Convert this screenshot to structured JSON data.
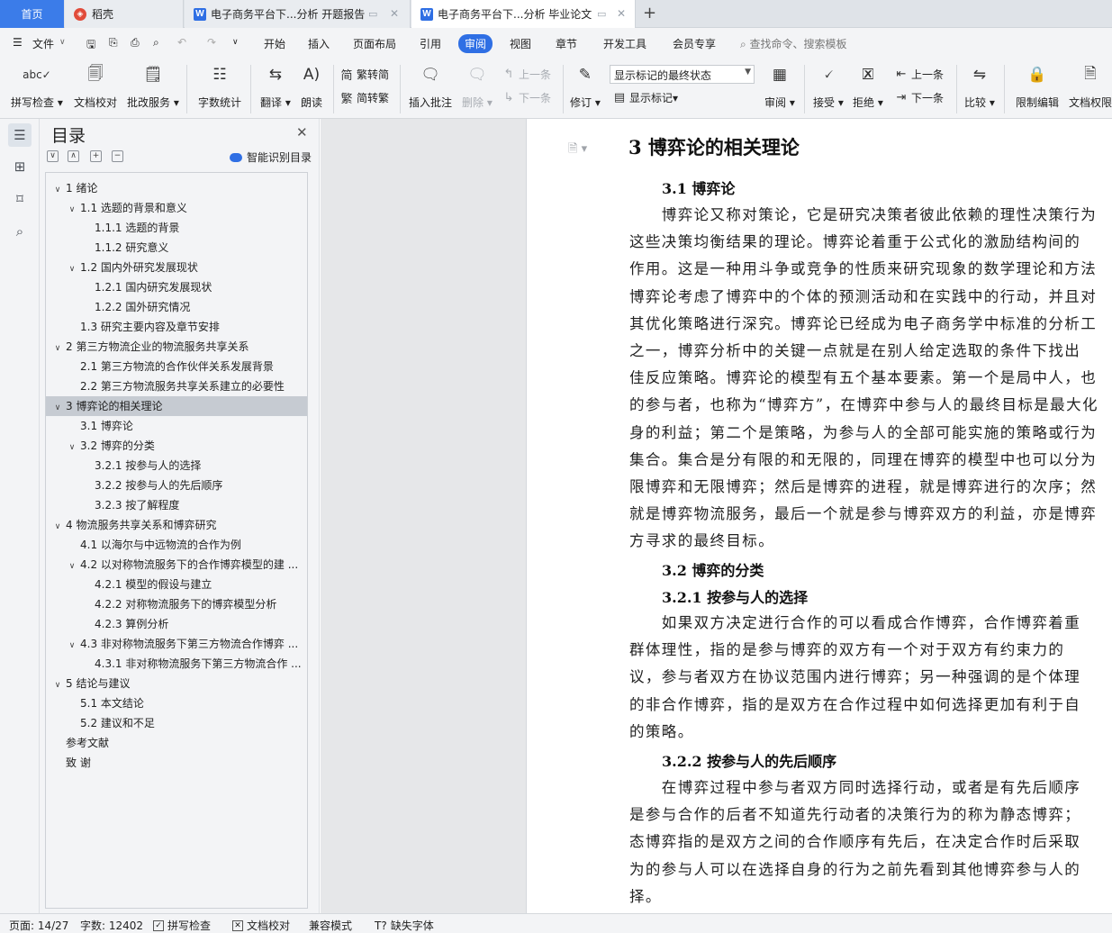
{
  "tabs": {
    "home": "首页",
    "daoke": "稻壳",
    "doc1": "电子商务平台下...分析 开题报告",
    "doc2": "电子商务平台下...分析 毕业论文"
  },
  "menu": {
    "file": "文件",
    "items": [
      "开始",
      "插入",
      "页面布局",
      "引用",
      "审阅",
      "视图",
      "章节",
      "开发工具",
      "会员专享"
    ],
    "active": "审阅",
    "search": "查找命令、搜索模板"
  },
  "ribbon": {
    "spellcheck": "拼写检查",
    "doc_proof": "文档校对",
    "batch_service": "批改服务",
    "word_count": "字数统计",
    "translate": "翻译",
    "read_aloud": "朗读",
    "trad_convert": "繁转简",
    "simp_convert": "简转繁",
    "insert_comment": "插入批注",
    "delete": "删除",
    "prev_comment": "上一条",
    "next_comment": "下一条",
    "track_changes": "修订",
    "markup_dropdown": "显示标记的最终状态",
    "show_markup": "显示标记",
    "review": "审阅",
    "accept": "接受",
    "reject": "拒绝",
    "prev_change": "上一条",
    "next_change": "下一条",
    "compare": "比较",
    "restrict_edit": "限制编辑",
    "doc_permission": "文档权限"
  },
  "toc": {
    "title": "目录",
    "smart": "智能识别目录",
    "items": [
      {
        "text": "1 绪论",
        "level": 1,
        "chevron": true
      },
      {
        "text": "1.1 选题的背景和意义",
        "level": 2,
        "chevron": true
      },
      {
        "text": "1.1.1 选题的背景",
        "level": 3,
        "chevron": false
      },
      {
        "text": "1.1.2 研究意义",
        "level": 3,
        "chevron": false
      },
      {
        "text": "1.2 国内外研究发展现状",
        "level": 2,
        "chevron": true
      },
      {
        "text": "1.2.1 国内研究发展现状",
        "level": 3,
        "chevron": false
      },
      {
        "text": "1.2.2 国外研究情况",
        "level": 3,
        "chevron": false
      },
      {
        "text": "1.3 研究主要内容及章节安排",
        "level": 2,
        "chevron": false
      },
      {
        "text": "2 第三方物流企业的物流服务共享关系",
        "level": 1,
        "chevron": true
      },
      {
        "text": "2.1 第三方物流的合作伙伴关系发展背景",
        "level": 2,
        "chevron": false
      },
      {
        "text": "2.2 第三方物流服务共享关系建立的必要性",
        "level": 2,
        "chevron": false
      },
      {
        "text": "3 博弈论的相关理论",
        "level": 1,
        "chevron": true,
        "selected": true
      },
      {
        "text": "3.1 博弈论",
        "level": 2,
        "chevron": false
      },
      {
        "text": "3.2 博弈的分类",
        "level": 2,
        "chevron": true
      },
      {
        "text": "3.2.1 按参与人的选择",
        "level": 3,
        "chevron": false
      },
      {
        "text": "3.2.2 按参与人的先后顺序",
        "level": 3,
        "chevron": false
      },
      {
        "text": "3.2.3 按了解程度",
        "level": 3,
        "chevron": false
      },
      {
        "text": "4 物流服务共享关系和博弈研究",
        "level": 1,
        "chevron": true
      },
      {
        "text": "4.1 以海尔与中远物流的合作为例",
        "level": 2,
        "chevron": false
      },
      {
        "text": "4.2 以对称物流服务下的合作博弈模型的建 ...",
        "level": 2,
        "chevron": true
      },
      {
        "text": "4.2.1 模型的假设与建立",
        "level": 3,
        "chevron": false
      },
      {
        "text": "4.2.2 对称物流服务下的博弈模型分析",
        "level": 3,
        "chevron": false
      },
      {
        "text": "4.2.3 算例分析",
        "level": 3,
        "chevron": false
      },
      {
        "text": "4.3 非对称物流服务下第三方物流合作博弈 ...",
        "level": 2,
        "chevron": true
      },
      {
        "text": "4.3.1 非对称物流服务下第三方物流合作 ...",
        "level": 3,
        "chevron": false
      },
      {
        "text": "5 结论与建议",
        "level": 1,
        "chevron": true
      },
      {
        "text": "5.1 本文结论",
        "level": 2,
        "chevron": false
      },
      {
        "text": "5.2 建议和不足",
        "level": 2,
        "chevron": false
      },
      {
        "text": "参考文献",
        "level": 1,
        "chevron": false,
        "nochev": true
      },
      {
        "text": "致  谢",
        "level": 1,
        "chevron": false,
        "nochev": true
      }
    ]
  },
  "document": {
    "heading": "3 博弈论的相关理论",
    "sec31": "3.1 博弈论",
    "p1": [
      "　　博弈论又称对策论，它是研究决策者彼此依赖的理性决策行为",
      "这些决策均衡结果的理论。博弈论着重于公式化的激励结构间的",
      "作用。这是一种用斗争或竞争的性质来研究现象的数学理论和方法",
      "博弈论考虑了博弈中的个体的预测活动和在实践中的行动，并且对",
      "其优化策略进行深究。博弈论已经成为电子商务学中标准的分析工",
      "之一，博弈分析中的关键一点就是在别人给定选取的条件下找出",
      "佳反应策略。博弈论的模型有五个基本要素。第一个是局中人，也",
      "的参与者，也称为“博弈方”，在博弈中参与人的最终目标是最大化",
      "身的利益；第二个是策略，为参与人的全部可能实施的策略或行为",
      "集合。集合是分有限的和无限的，同理在博弈的模型中也可以分为",
      "限博弈和无限博弈；然后是博弈的进程，就是博弈进行的次序；然",
      "就是博弈物流服务，最后一个就是参与博弈双方的利益，亦是博弈",
      "方寻求的最终目标。"
    ],
    "sec32": "3.2 博弈的分类",
    "sec321": "3.2.1 按参与人的选择",
    "p2": [
      "　　如果双方决定进行合作的可以看成合作博弈，合作博弈着重",
      "群体理性，指的是参与博弈的双方有一个对于双方有约束力的",
      "议，参与者双方在协议范围内进行博弈；另一种强调的是个体理",
      "的非合作博弈，指的是双方在合作过程中如何选择更加有利于自",
      "的策略。"
    ],
    "sec322": "3.2.2 按参与人的先后顺序",
    "p3": [
      "　　在博弈过程中参与者双方同时选择行动，或者是有先后顺序",
      "是参与合作的后者不知道先行动者的决策行为的称为静态博弈；",
      "态博弈指的是双方之间的合作顺序有先后，在决定合作时后采取",
      "为的参与人可以在选择自身的行为之前先看到其他博弈参与人的",
      "择。"
    ]
  },
  "status": {
    "page": "页面: 14/27",
    "words": "字数: 12402",
    "spell": "拼写检查",
    "proof": "文档校对",
    "compat": "兼容模式",
    "missing_font": "缺失字体"
  }
}
